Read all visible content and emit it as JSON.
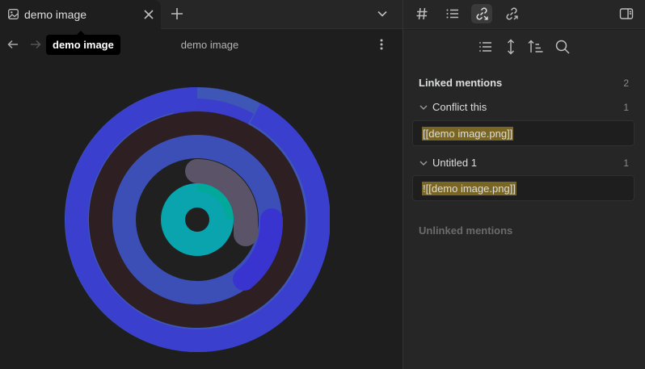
{
  "tab": {
    "title": "demo image",
    "icon": "image-icon",
    "close_icon": "close-icon"
  },
  "toolbar": {
    "new_tab_icon": "plus-icon",
    "tab_list_icon": "chevron-down-icon"
  },
  "right_toolbar": [
    "hash-icon",
    "list-icon",
    "backlinks-icon",
    "outgoing-links-icon",
    "sidebar-toggle-icon"
  ],
  "view": {
    "title": "demo image",
    "tooltip": "demo image"
  },
  "image": {
    "description_icon": "concentric-rings",
    "colors": {
      "outer": "#3d51b8",
      "outer2": "#3b38cf",
      "band": "#2e1f22",
      "ring3": "#3a45c8",
      "inner_bg": "#222",
      "grey": "#5a5368",
      "teal": "#00a6a6",
      "teal_dark": "#0e8fb0"
    }
  },
  "backlinks": {
    "linked_label": "Linked mentions",
    "linked_count": "2",
    "groups": [
      {
        "title": "Conflict this",
        "count": "1",
        "snippet": "[[demo image.png]]"
      },
      {
        "title": "Untitled 1",
        "count": "1",
        "snippet": "![[demo image.png]]"
      }
    ],
    "unlinked_label": "Unlinked mentions"
  }
}
